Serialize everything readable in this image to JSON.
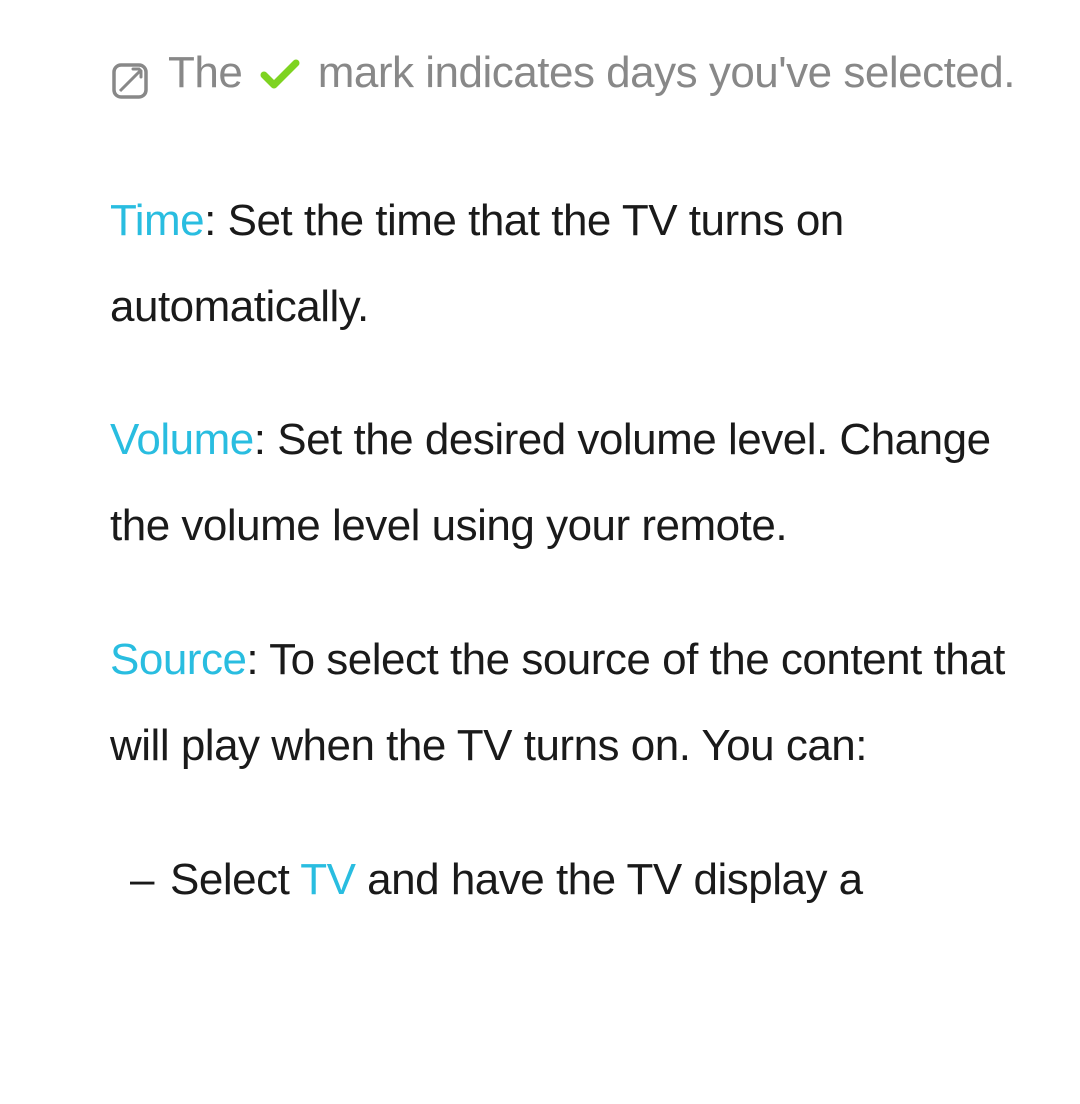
{
  "note": {
    "text_before": "The ",
    "text_after": " mark indicates days you've selected."
  },
  "entries": {
    "time": {
      "label": "Time",
      "desc": ": Set the time that the TV turns on automatically."
    },
    "volume": {
      "label": "Volume",
      "desc": ": Set the desired volume level. Change the volume level using your remote."
    },
    "source": {
      "label": "Source",
      "desc": ": To select the source of the content that will play when the TV turns on. You can:"
    }
  },
  "subitem": {
    "dash": "–",
    "prefix": " Select ",
    "label": "TV",
    "suffix": " and have the TV display a"
  }
}
